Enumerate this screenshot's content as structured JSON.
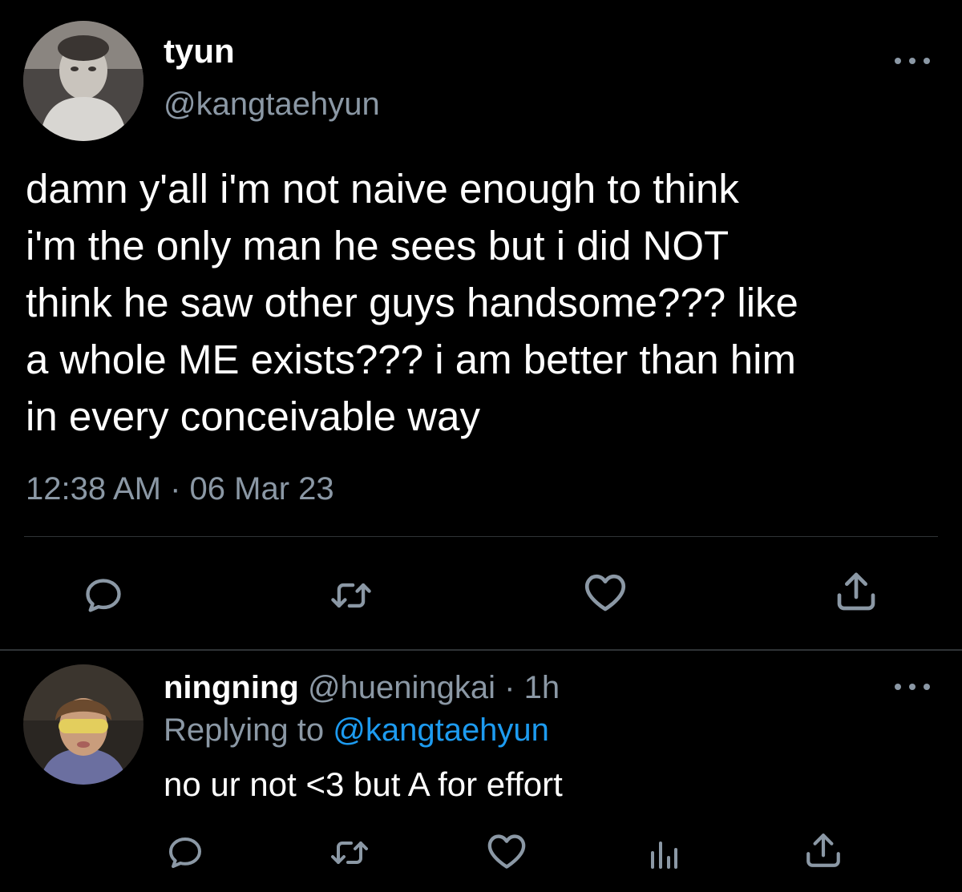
{
  "colors": {
    "background": "#000000",
    "primary_text": "#ffffff",
    "secondary_text": "#8b98a5",
    "link": "#1d9bf0",
    "divider": "#2f3336"
  },
  "tweet": {
    "display_name": "tyun",
    "handle": "@kangtaehyun",
    "text": "damn y'all i'm not naive enough to think\ni'm the only man he sees but i did NOT\nthink he saw other guys handsome??? like\na whole ME exists??? i am better than him\nin every conceivable way",
    "timestamp": "12:38 AM · 06 Mar 23",
    "avatar_icon": "user-avatar-photo",
    "more_icon": "more-dots-icon",
    "actions": [
      "reply-icon",
      "retweet-icon",
      "like-icon",
      "share-icon"
    ]
  },
  "reply": {
    "display_name": "ningning",
    "handle": "@hueningkai",
    "separator": " · ",
    "time_ago": "1h",
    "replying_prefix": "Replying to ",
    "replying_to": "@kangtaehyun",
    "text": "no ur not <3 but A for effort",
    "avatar_icon": "user-avatar-photo",
    "more_icon": "more-dots-icon",
    "actions": [
      "reply-icon",
      "retweet-icon",
      "like-icon",
      "analytics-icon",
      "share-icon"
    ]
  }
}
